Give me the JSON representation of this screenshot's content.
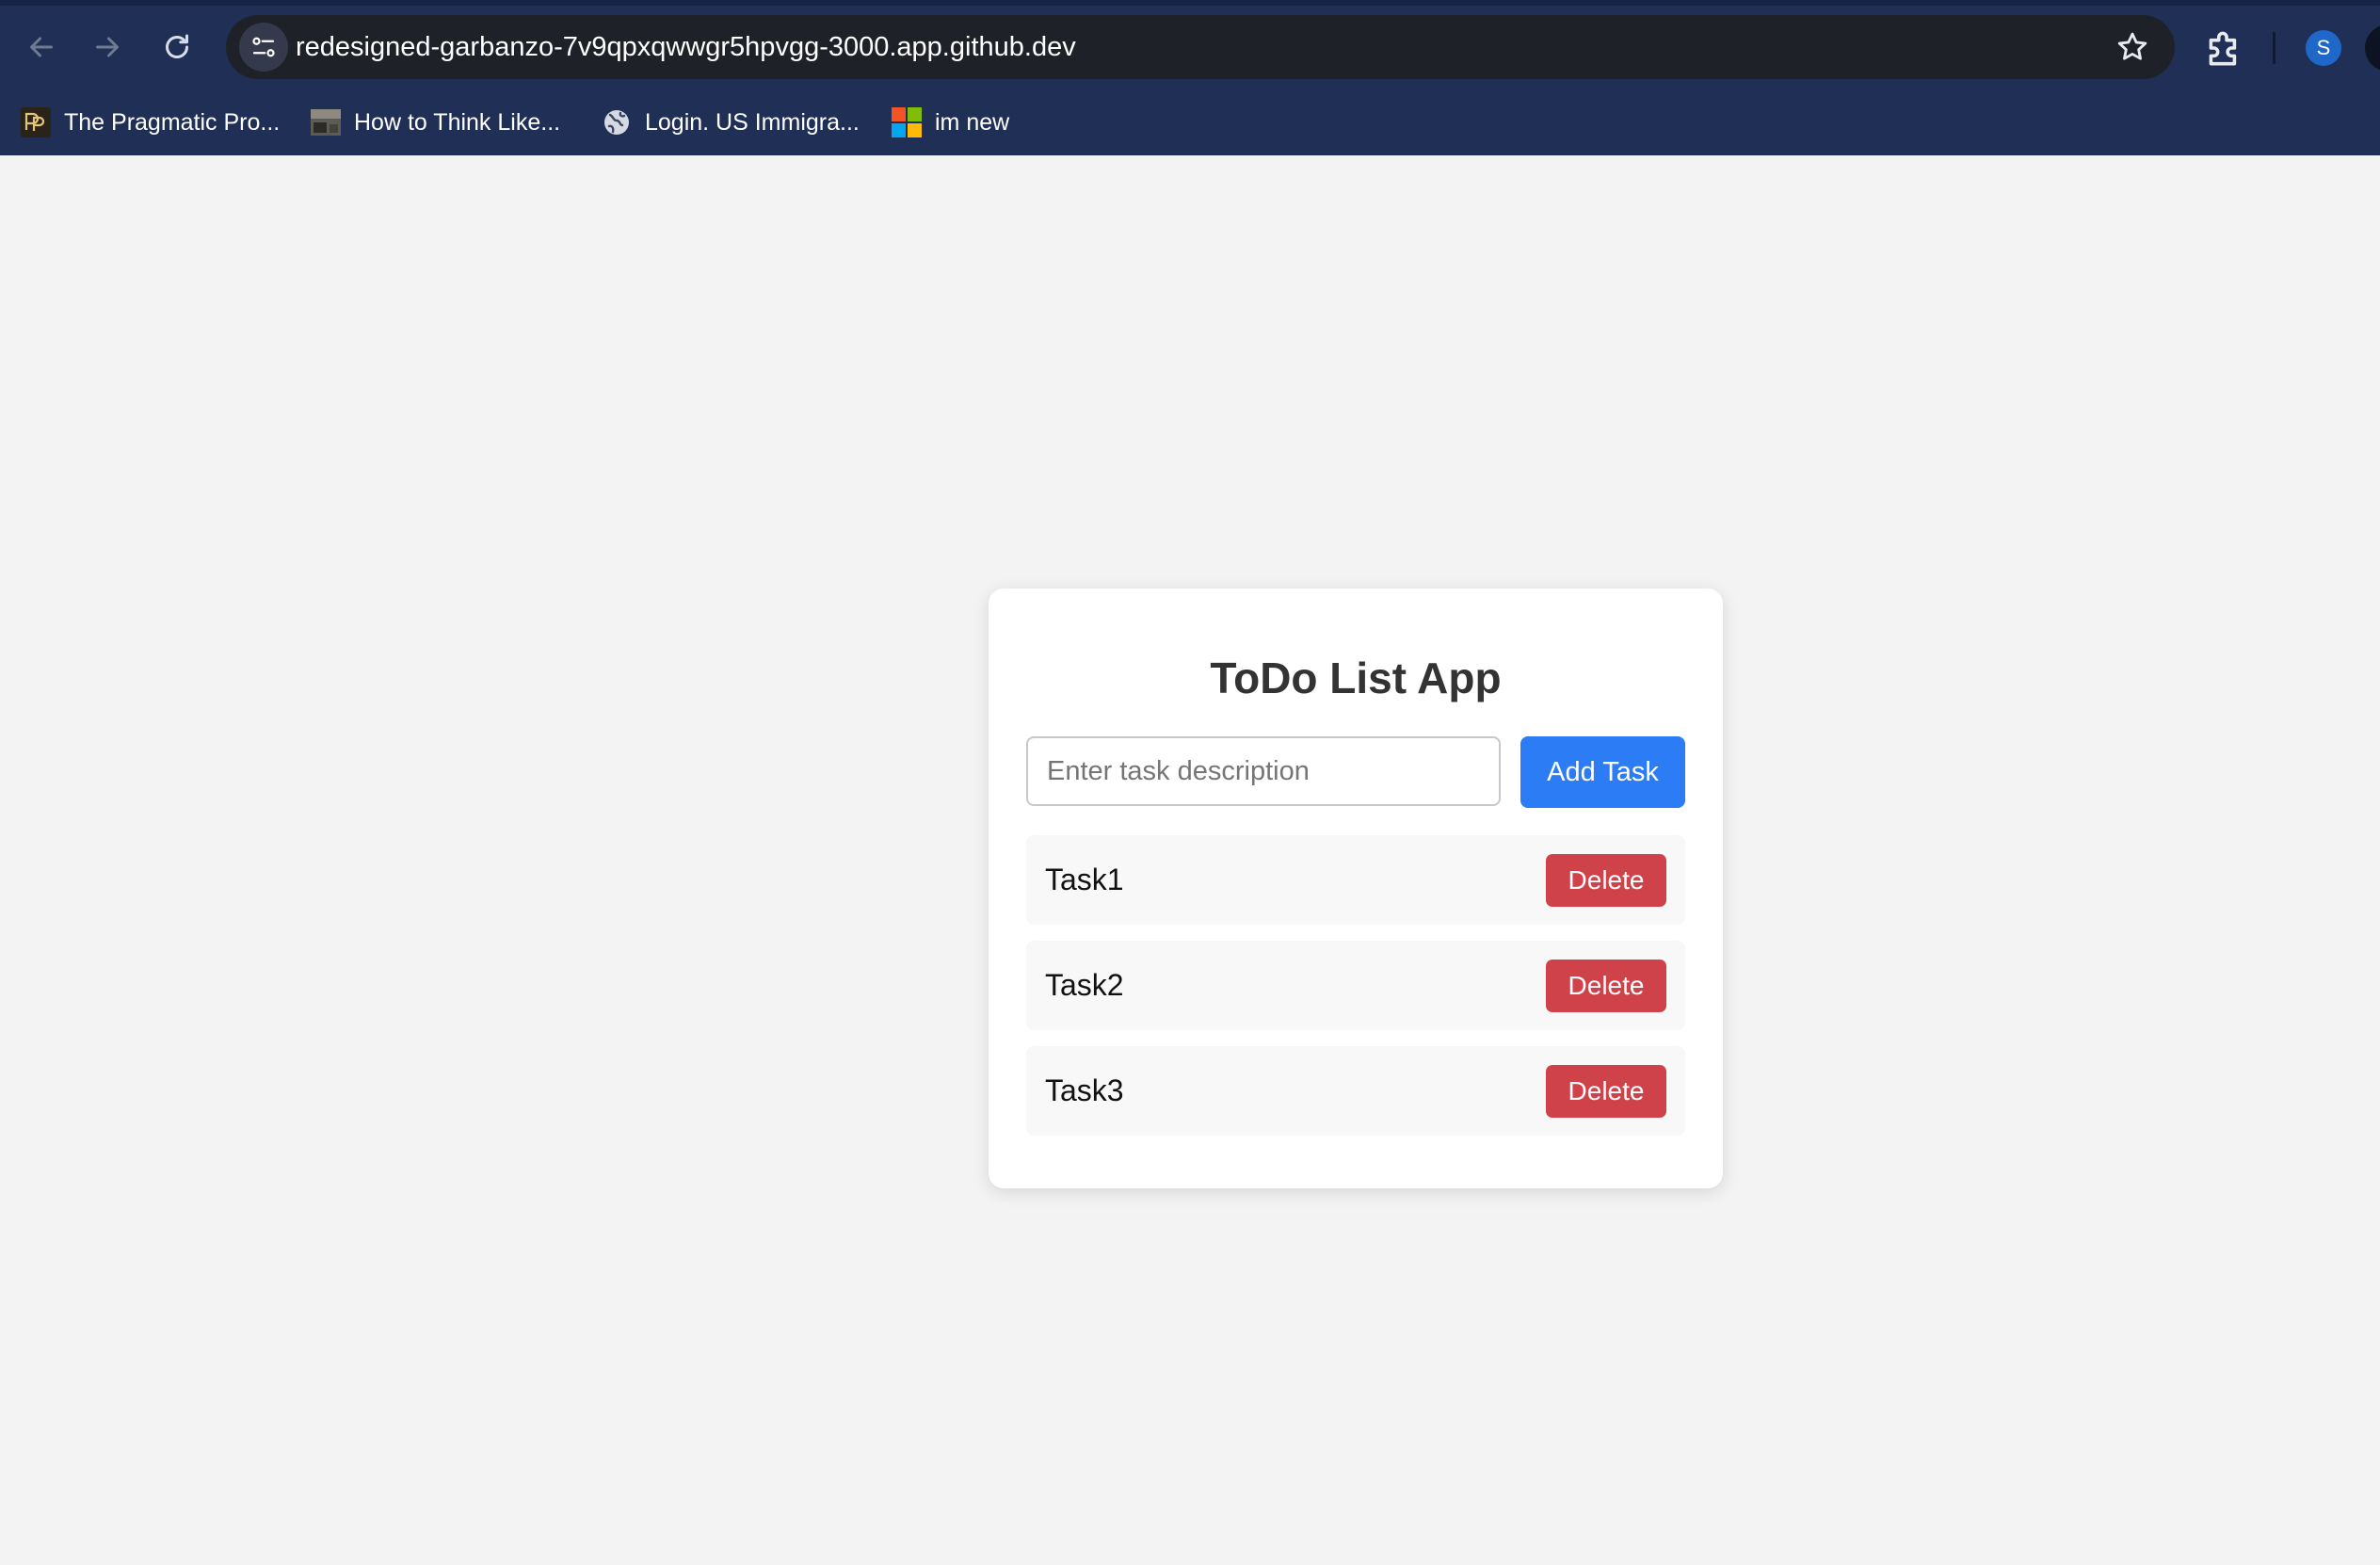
{
  "browser": {
    "url": "redesigned-garbanzo-7v9qpxqwwgr5hpvgg-3000.app.github.dev",
    "avatar_initial": "S",
    "bookmarks": [
      {
        "label": "The Pragmatic Pro...",
        "icon": "pragmatic-programmer-favicon"
      },
      {
        "label": "How to Think Like...",
        "icon": "book-thumbnail-favicon"
      },
      {
        "label": "Login. US Immigra...",
        "icon": "globe-icon"
      },
      {
        "label": "im new",
        "icon": "microsoft-logo-icon"
      }
    ],
    "colors": {
      "toolbar": "#1f2f55",
      "omnibox": "#1e2127"
    }
  },
  "app": {
    "title": "ToDo List App",
    "input": {
      "placeholder": "Enter task description",
      "value": ""
    },
    "add_button_label": "Add Task",
    "tasks": [
      {
        "text": "Task1",
        "delete_label": "Delete"
      },
      {
        "text": "Task2",
        "delete_label": "Delete"
      },
      {
        "text": "Task3",
        "delete_label": "Delete"
      }
    ],
    "colors": {
      "add_button": "#2c7cf6",
      "delete_button": "#d0424a",
      "page_background": "#f3f3f3"
    }
  }
}
